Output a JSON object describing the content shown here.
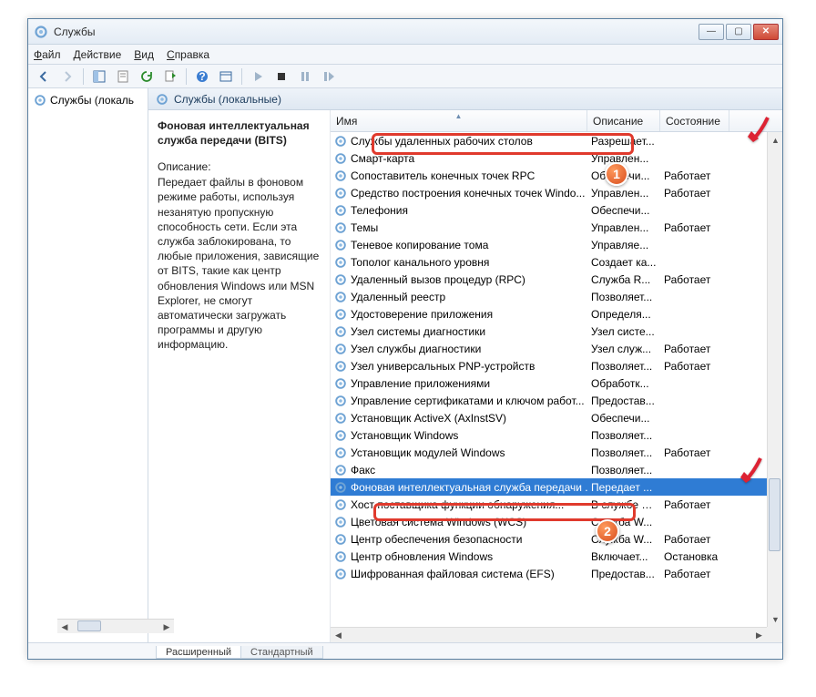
{
  "window": {
    "title": "Службы"
  },
  "menu": {
    "file": "Файл",
    "action": "Действие",
    "view": "Вид",
    "help": "Справка"
  },
  "tree": {
    "root": "Службы (локаль"
  },
  "panel": {
    "header": "Службы (локальные)"
  },
  "detail": {
    "title": "Фоновая интеллектуальная служба передачи (BITS)",
    "label": "Описание:",
    "desc": "Передает файлы в фоновом режиме работы, используя незанятую пропускную способность сети. Если эта служба заблокирована, то любые приложения, зависящие от BITS, такие как центр обновления Windows или MSN Explorer, не смогут автоматически загружать программы и другую информацию."
  },
  "columns": {
    "name": "Имя",
    "desc": "Описание",
    "state": "Состояние"
  },
  "rows": [
    {
      "name": "Службы удаленных рабочих столов",
      "desc": "Разрешает...",
      "state": ""
    },
    {
      "name": "Смарт-карта",
      "desc": "Управлен...",
      "state": ""
    },
    {
      "name": "Сопоставитель конечных точек RPC",
      "desc": "Обеспечи...",
      "state": "Работает"
    },
    {
      "name": "Средство построения конечных точек Windo...",
      "desc": "Управлен...",
      "state": "Работает"
    },
    {
      "name": "Телефония",
      "desc": "Обеспечи...",
      "state": ""
    },
    {
      "name": "Темы",
      "desc": "Управлен...",
      "state": "Работает"
    },
    {
      "name": "Теневое копирование тома",
      "desc": "Управляе...",
      "state": ""
    },
    {
      "name": "Тополог канального уровня",
      "desc": "Создает ка...",
      "state": ""
    },
    {
      "name": "Удаленный вызов процедур (RPC)",
      "desc": "Служба R...",
      "state": "Работает"
    },
    {
      "name": "Удаленный реестр",
      "desc": "Позволяет...",
      "state": ""
    },
    {
      "name": "Удостоверение приложения",
      "desc": "Определя...",
      "state": ""
    },
    {
      "name": "Узел системы диагностики",
      "desc": "Узел систе...",
      "state": ""
    },
    {
      "name": "Узел службы диагностики",
      "desc": "Узел служ...",
      "state": "Работает"
    },
    {
      "name": "Узел универсальных PNP-устройств",
      "desc": "Позволяет...",
      "state": "Работает"
    },
    {
      "name": "Управление приложениями",
      "desc": "Обработк...",
      "state": ""
    },
    {
      "name": "Управление сертификатами и ключом работ...",
      "desc": "Предостав...",
      "state": ""
    },
    {
      "name": "Установщик ActiveX (AxInstSV)",
      "desc": "Обеспечи...",
      "state": ""
    },
    {
      "name": "Установщик Windows",
      "desc": "Позволяет...",
      "state": ""
    },
    {
      "name": "Установщик модулей Windows",
      "desc": "Позволяет...",
      "state": "Работает"
    },
    {
      "name": "Факс",
      "desc": "Позволяет...",
      "state": ""
    },
    {
      "name": "Фоновая интеллектуальная служба передачи ...",
      "desc": "Передает ...",
      "state": "",
      "selected": true
    },
    {
      "name": "Хост поставщика функции обнаружения...",
      "desc": "В службе б...",
      "state": "Работает"
    },
    {
      "name": "Цветовая система Windows (WCS)",
      "desc": "Служба W...",
      "state": ""
    },
    {
      "name": "Центр обеспечения безопасности",
      "desc": "Служба W...",
      "state": "Работает"
    },
    {
      "name": "Центр обновления Windows",
      "desc": "Включает...",
      "state": "Остановка"
    },
    {
      "name": "Шифрованная файловая система (EFS)",
      "desc": "Предостав...",
      "state": "Работает"
    }
  ],
  "tabs": {
    "ext": "Расширенный",
    "std": "Стандартный"
  }
}
